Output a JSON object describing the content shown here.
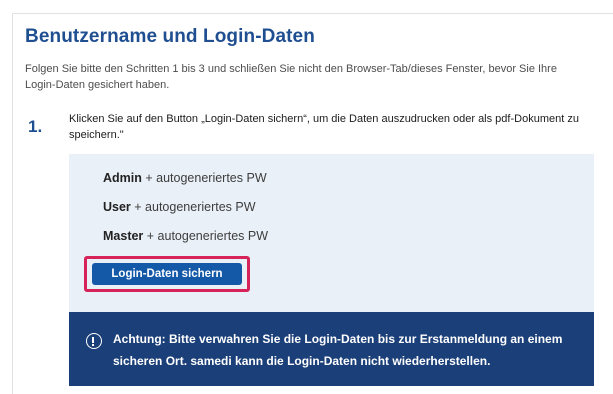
{
  "heading": "Benutzername und Login-Daten",
  "intro": "Folgen Sie bitte den Schritten 1 bis 3 und schließen Sie nicht den Browser-Tab/dieses Fenster, bevor Sie Ihre Login-Daten gesichert haben.",
  "step": {
    "number": "1.",
    "text": "Klicken Sie auf den Button „Login-Daten sichern“, um die Daten auszudrucken oder als pdf-Dokument zu speichern.\""
  },
  "credentials": [
    {
      "role": "Admin",
      "desc": "+ autogeneriertes PW"
    },
    {
      "role": "User",
      "desc": "+ autogeneriertes PW"
    },
    {
      "role": "Master",
      "desc": "+ autogeneriertes PW"
    }
  ],
  "save_button": {
    "label": "Login-Daten sichern",
    "highlight_color": "#d6245a",
    "color": "#1458a8"
  },
  "warning": {
    "icon": "info-circle-icon",
    "text": "Achtung: Bitte verwahren Sie die Login-Daten bis zur Erstanmeldung an einem sicheren Ort. samedi kann die Login-Daten nicht wiederherstellen.",
    "background": "#1b3f78"
  },
  "colors": {
    "heading": "#1f4e91",
    "credential_box": "#e9f0f7"
  }
}
